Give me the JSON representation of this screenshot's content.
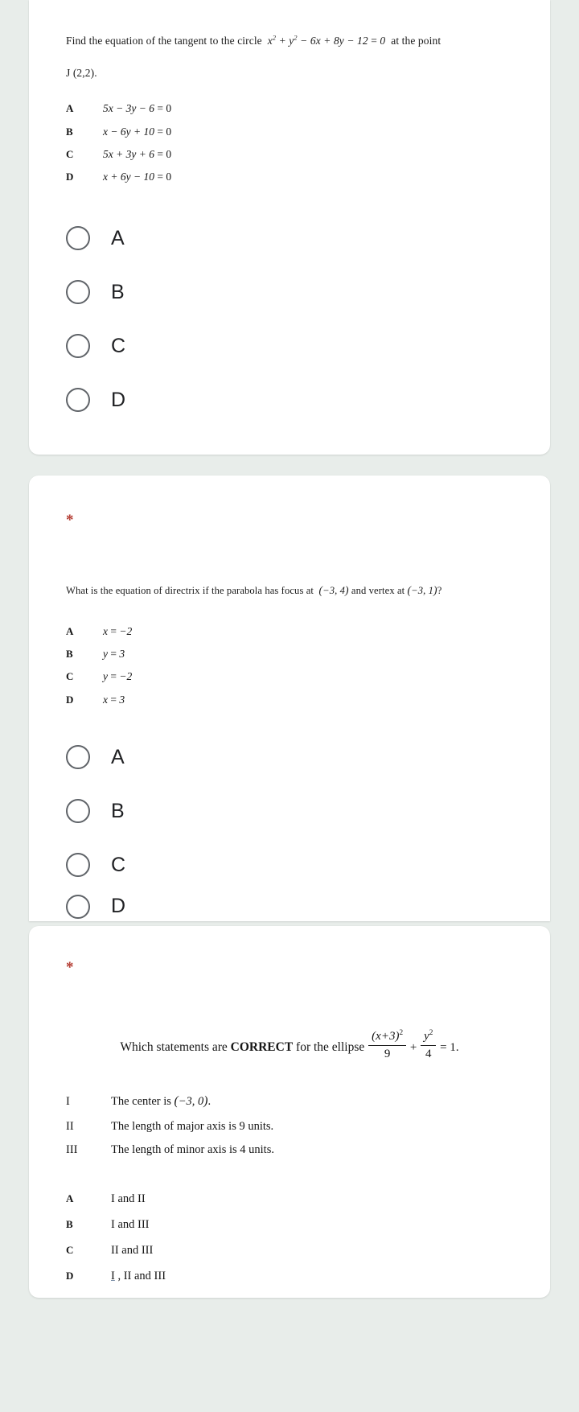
{
  "page": {
    "background_color": "#e8edea",
    "card_color": "#ffffff",
    "required_marker": "*",
    "required_marker_color": "#b33a30"
  },
  "questions": [
    {
      "id": "q1-tangent-circle",
      "stem_line1_prefix": "Find the equation of the tangent to the circle",
      "stem_equation": "x² + y² − 6x + 8y − 12 = 0",
      "stem_line1_suffix": "at the point",
      "stem_line2": "J (2,2).",
      "options": [
        {
          "letter": "A",
          "text": "5x − 3y − 6 = 0"
        },
        {
          "letter": "B",
          "text": "x − 6y + 10 = 0"
        },
        {
          "letter": "C",
          "text": "5x + 3y + 6 = 0"
        },
        {
          "letter": "D",
          "text": "x + 6y − 10 = 0"
        }
      ],
      "choices": [
        {
          "value": "A",
          "label": "A",
          "selected": false
        },
        {
          "value": "B",
          "label": "B",
          "selected": false
        },
        {
          "value": "C",
          "label": "C",
          "selected": false
        },
        {
          "value": "D",
          "label": "D",
          "selected": false
        }
      ]
    },
    {
      "id": "q2-parabola-directrix",
      "stem_prefix": "What is the equation of directrix if the parabola has focus at",
      "focus_point": "(−3, 4)",
      "stem_middle": "and vertex at",
      "vertex_point": "(−3, 1)",
      "stem_suffix": "?",
      "options": [
        {
          "letter": "A",
          "text": "x = −2"
        },
        {
          "letter": "B",
          "text": "y = 3"
        },
        {
          "letter": "C",
          "text": "y = −2"
        },
        {
          "letter": "D",
          "text": "x = 3"
        }
      ],
      "choices": [
        {
          "value": "A",
          "label": "A",
          "selected": false
        },
        {
          "value": "B",
          "label": "B",
          "selected": false
        },
        {
          "value": "C",
          "label": "C",
          "selected": false
        },
        {
          "value": "D",
          "label": "D",
          "selected": false
        }
      ]
    },
    {
      "id": "q3-ellipse-statements",
      "stem_prefix": "Which statements are",
      "stem_emphasis": "CORRECT",
      "stem_after": "for the ellipse",
      "equation": {
        "term1_numerator": "(x+3)²",
        "term1_denominator": "9",
        "operator": "+",
        "term2_numerator": "y²",
        "term2_denominator": "4",
        "equals": "= 1."
      },
      "statements": [
        {
          "numeral": "I",
          "text": "The center is (−3, 0)."
        },
        {
          "numeral": "II",
          "text": "The length of major axis is 9 units."
        },
        {
          "numeral": "III",
          "text": "The length of minor axis is 4 units."
        }
      ],
      "options": [
        {
          "letter": "A",
          "text": "I and II"
        },
        {
          "letter": "B",
          "text": "I and III"
        },
        {
          "letter": "C",
          "text": "II and III"
        },
        {
          "letter": "D",
          "text": "I , II and III"
        }
      ]
    }
  ]
}
